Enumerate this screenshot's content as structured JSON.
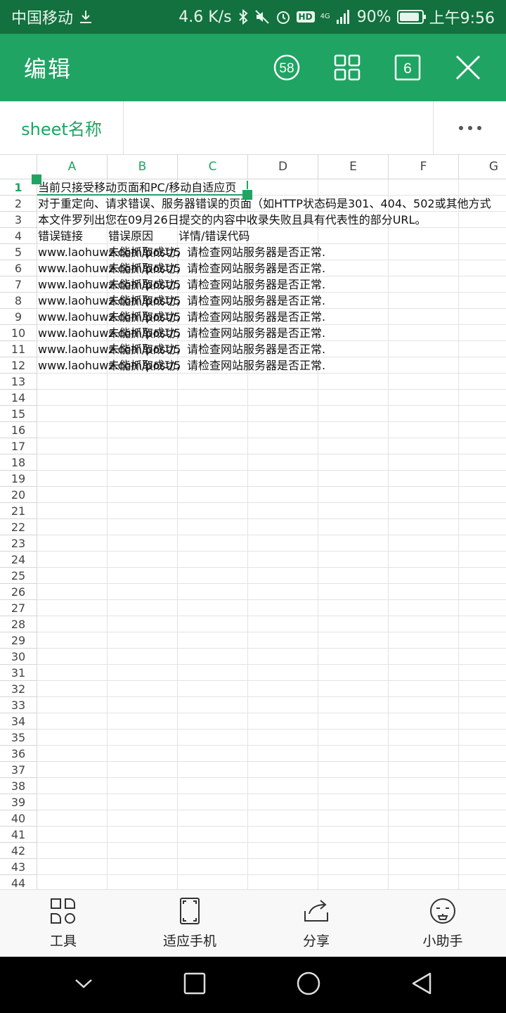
{
  "status_bar": {
    "carrier": "中国移动",
    "speed": "4.6 K/s",
    "hd": "HD",
    "network": "4G",
    "battery": "90%",
    "battery_level": 0.9,
    "time": "上午9:56"
  },
  "app_bar": {
    "title": "编辑",
    "badge_count": "58",
    "sheet_count": "6"
  },
  "tab_bar": {
    "sheet_tab_label": "sheet名称"
  },
  "grid": {
    "columns": [
      "A",
      "B",
      "C",
      "D",
      "E",
      "F",
      "G"
    ],
    "selected_columns": [
      "A",
      "B",
      "C"
    ],
    "selected_row": "1",
    "row_numbers": [
      "1",
      "2",
      "3",
      "4",
      "5",
      "6",
      "7",
      "8",
      "9",
      "10",
      "11",
      "12",
      "13",
      "14",
      "15",
      "16",
      "17",
      "18",
      "19",
      "20",
      "21",
      "22",
      "23",
      "24",
      "25",
      "26",
      "27",
      "28",
      "29",
      "30",
      "31",
      "32",
      "33",
      "34",
      "35",
      "36",
      "37",
      "38",
      "39",
      "40",
      "41",
      "42",
      "43",
      "44"
    ],
    "cells": [
      {
        "row": 1,
        "col": "A",
        "text": "当前只接受移动页面和PC/移动自适应页"
      },
      {
        "row": 2,
        "col": "A",
        "text": "对于重定向、请求错误、服务器错误的页面（如HTTP状态码是301、404、502或其他方式"
      },
      {
        "row": 3,
        "col": "A",
        "text": "本文件罗列出您在09月26日提交的内容中收录失败且具有代表性的部分URL。"
      },
      {
        "row": 4,
        "col": "A",
        "text": "错误链接"
      },
      {
        "row": 4,
        "col": "B",
        "text": "错误原因"
      },
      {
        "row": 4,
        "col": "C",
        "text": "详情/错误代码"
      },
      {
        "row": 5,
        "col": "A",
        "text": "www.laohuwz.com/post/5"
      },
      {
        "row": 5,
        "col": "B",
        "text": "未能抓取成功，请检查网站服务器是否正常."
      },
      {
        "row": 6,
        "col": "A",
        "text": "www.laohuwz.com/post/5"
      },
      {
        "row": 6,
        "col": "B",
        "text": "未能抓取成功，请检查网站服务器是否正常."
      },
      {
        "row": 7,
        "col": "A",
        "text": "www.laohuwz.com/post/5"
      },
      {
        "row": 7,
        "col": "B",
        "text": "未能抓取成功，请检查网站服务器是否正常."
      },
      {
        "row": 8,
        "col": "A",
        "text": "www.laohuwz.com/post/5"
      },
      {
        "row": 8,
        "col": "B",
        "text": "未能抓取成功，请检查网站服务器是否正常."
      },
      {
        "row": 9,
        "col": "A",
        "text": "www.laohuwz.com/post/5"
      },
      {
        "row": 9,
        "col": "B",
        "text": "未能抓取成功，请检查网站服务器是否正常."
      },
      {
        "row": 10,
        "col": "A",
        "text": "www.laohuwz.com/post/5"
      },
      {
        "row": 10,
        "col": "B",
        "text": "未能抓取成功，请检查网站服务器是否正常."
      },
      {
        "row": 11,
        "col": "A",
        "text": "www.laohuwz.com/post/5"
      },
      {
        "row": 11,
        "col": "B",
        "text": "未能抓取成功，请检查网站服务器是否正常."
      },
      {
        "row": 12,
        "col": "A",
        "text": "www.laohuwz.com/post/5"
      },
      {
        "row": 12,
        "col": "B",
        "text": "未能抓取成功，请检查网站服务器是否正常."
      }
    ]
  },
  "bottom_bar": {
    "items": [
      {
        "label": "工具",
        "icon": "tools-icon"
      },
      {
        "label": "适应手机",
        "icon": "fit-screen-icon"
      },
      {
        "label": "分享",
        "icon": "share-icon"
      },
      {
        "label": "小助手",
        "icon": "assistant-icon"
      }
    ]
  },
  "colors": {
    "accent": "#1fa463",
    "status_bar": "#13703f"
  }
}
